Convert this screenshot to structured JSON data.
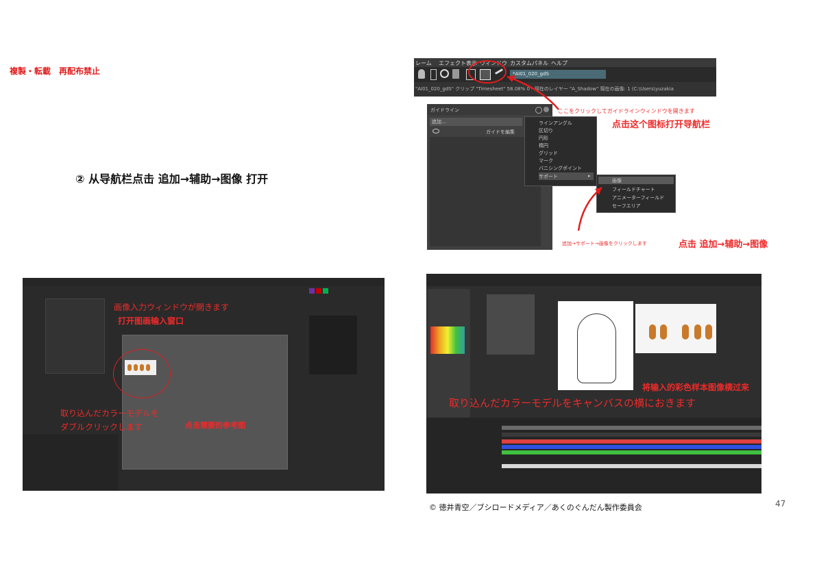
{
  "notice": "複製・転載　再配布禁止",
  "step_title": "② 从导航栏点击 追加→辅助→图像 打开",
  "top_right": {
    "menu_items": [
      "レーム",
      "エフェクト",
      "表示",
      "ウィンドウ",
      "カスタムパネル",
      "ヘルプ"
    ],
    "file_field": "*AI01_020_gdS",
    "status_line": "\"AI01_020_gdS\" クリップ \"Timesheet\" 58.08% 0 - 現在のレイヤー \"A_Shadow\" 現在の画像: 1 (C:\\Users\\yuzakia",
    "ann_jp": "ここをクリックしてガイドラインウィンドウを開きます",
    "ann_cn": "点击这个图标打开导航栏"
  },
  "guide_panel": {
    "title": "ガイドライン",
    "add": "追加...",
    "edit": "ガイドを編集",
    "submenu": [
      "ラインアングル",
      "区切り",
      "円形",
      "楕円",
      "グリッド",
      "マーク",
      "バニシングポイント",
      "サポート"
    ],
    "support_menu": [
      "画像",
      "フィールドチャート",
      "アニメーターフィールド",
      "セーフエリア"
    ],
    "ann_jp": "追加→サポート→画像をクリックします",
    "ann_cn": "点击 追加→辅助→图像"
  },
  "bottom_left": {
    "ann1_jp": "画像入力ウィンドウが開きます",
    "ann1_cn": "打开图画输入窗口",
    "ann2_jp_line1": "取り込んだカラーモデルを",
    "ann2_jp_line2": "ダブルクリックします",
    "ann2_cn": "点击需要的参考图"
  },
  "bottom_right": {
    "ann_cn": "将输入的彩色样本图像横过来",
    "ann_jp": "取り込んだカラーモデルをキャンバスの横におきます"
  },
  "credit": "© 徳井青空／ブシロードメディア／あくのぐんだん製作委員会",
  "page_number": "47",
  "colors": {
    "annotation": "#e01e1e",
    "ui_dark": "#2c2c2c",
    "highlight": "#6fa8dc"
  }
}
